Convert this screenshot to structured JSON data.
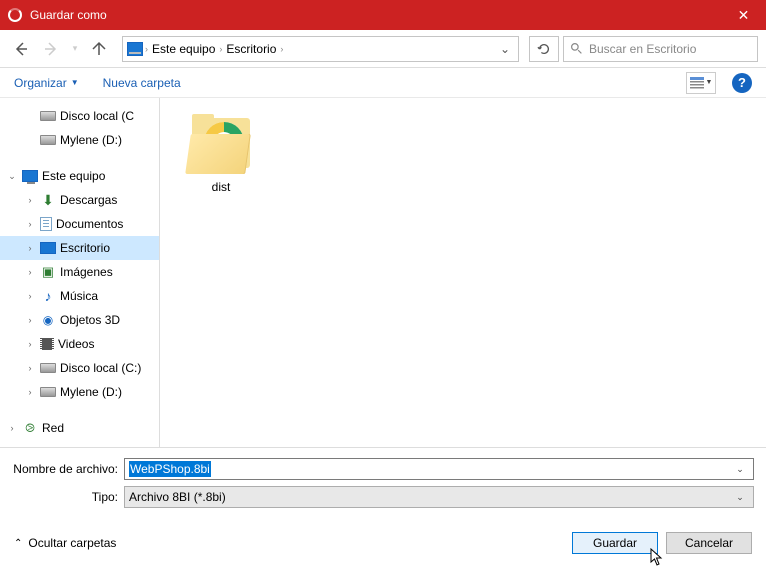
{
  "title": "Guardar como",
  "breadcrumb": {
    "root": "Este equipo",
    "folder": "Escritorio"
  },
  "search_placeholder": "Buscar en Escritorio",
  "organize": "Organizar",
  "new_folder": "Nueva carpeta",
  "tree": {
    "disk_c": "Disco local (C",
    "mylene_d_top": "Mylene (D:)",
    "this_pc": "Este equipo",
    "downloads": "Descargas",
    "documents": "Documentos",
    "desktop": "Escritorio",
    "pictures": "Imágenes",
    "music": "Música",
    "objects3d": "Objetos 3D",
    "videos": "Videos",
    "disk_c_full": "Disco local (C:)",
    "mylene_d": "Mylene (D:)",
    "network": "Red"
  },
  "content_folder": "dist",
  "filename_label": "Nombre de archivo:",
  "filename_value": "WebPShop.8bi",
  "type_label": "Tipo:",
  "type_value": "Archivo 8BI (*.8bi)",
  "hide_folders": "Ocultar carpetas",
  "save": "Guardar",
  "cancel": "Cancelar"
}
